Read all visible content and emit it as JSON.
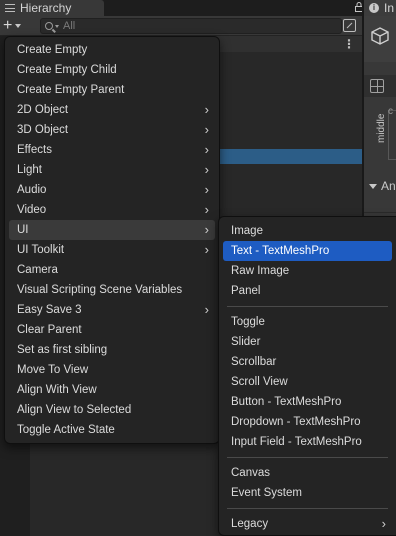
{
  "hierarchy": {
    "tab_label": "Hierarchy",
    "search_placeholder": "All"
  },
  "inspector": {
    "tab_label": "In",
    "anchor_label": "middle",
    "section_label": "An",
    "c_label": "c"
  },
  "create_menu": {
    "items": [
      {
        "label": "Create Empty",
        "submenu": false
      },
      {
        "label": "Create Empty Child",
        "submenu": false
      },
      {
        "label": "Create Empty Parent",
        "submenu": false
      },
      {
        "label": "2D Object",
        "submenu": true
      },
      {
        "label": "3D Object",
        "submenu": true
      },
      {
        "label": "Effects",
        "submenu": true
      },
      {
        "label": "Light",
        "submenu": true
      },
      {
        "label": "Audio",
        "submenu": true
      },
      {
        "label": "Video",
        "submenu": true
      },
      {
        "label": "UI",
        "submenu": true,
        "highlighted": true
      },
      {
        "label": "UI Toolkit",
        "submenu": true
      },
      {
        "label": "Camera",
        "submenu": false
      },
      {
        "label": "Visual Scripting Scene Variables",
        "submenu": false
      },
      {
        "label": "Easy Save 3",
        "submenu": true
      },
      {
        "label": "Clear Parent",
        "submenu": false
      },
      {
        "label": "Set as first sibling",
        "submenu": false
      },
      {
        "label": "Move To View",
        "submenu": false
      },
      {
        "label": "Align With View",
        "submenu": false
      },
      {
        "label": "Align View to Selected",
        "submenu": false
      },
      {
        "label": "Toggle Active State",
        "submenu": false
      }
    ]
  },
  "ui_submenu": {
    "items": [
      {
        "label": "Image"
      },
      {
        "label": "Text - TextMeshPro",
        "selected": true
      },
      {
        "label": "Raw Image"
      },
      {
        "label": "Panel"
      },
      {
        "separator": true
      },
      {
        "label": "Toggle"
      },
      {
        "label": "Slider"
      },
      {
        "label": "Scrollbar"
      },
      {
        "label": "Scroll View"
      },
      {
        "label": "Button - TextMeshPro"
      },
      {
        "label": "Dropdown - TextMeshPro"
      },
      {
        "label": "Input Field - TextMeshPro"
      },
      {
        "separator": true
      },
      {
        "label": "Canvas"
      },
      {
        "label": "Event System"
      },
      {
        "separator": true
      },
      {
        "label": "Legacy",
        "submenu": true
      }
    ]
  },
  "icons": {
    "submenu_arrow": "chevron-right-icon",
    "lock": "lock-icon",
    "more": "kebab-menu-icon"
  },
  "colors": {
    "selection": "#1e5cc2",
    "row_selection": "#2c5d87",
    "menu_bg": "#242424"
  }
}
